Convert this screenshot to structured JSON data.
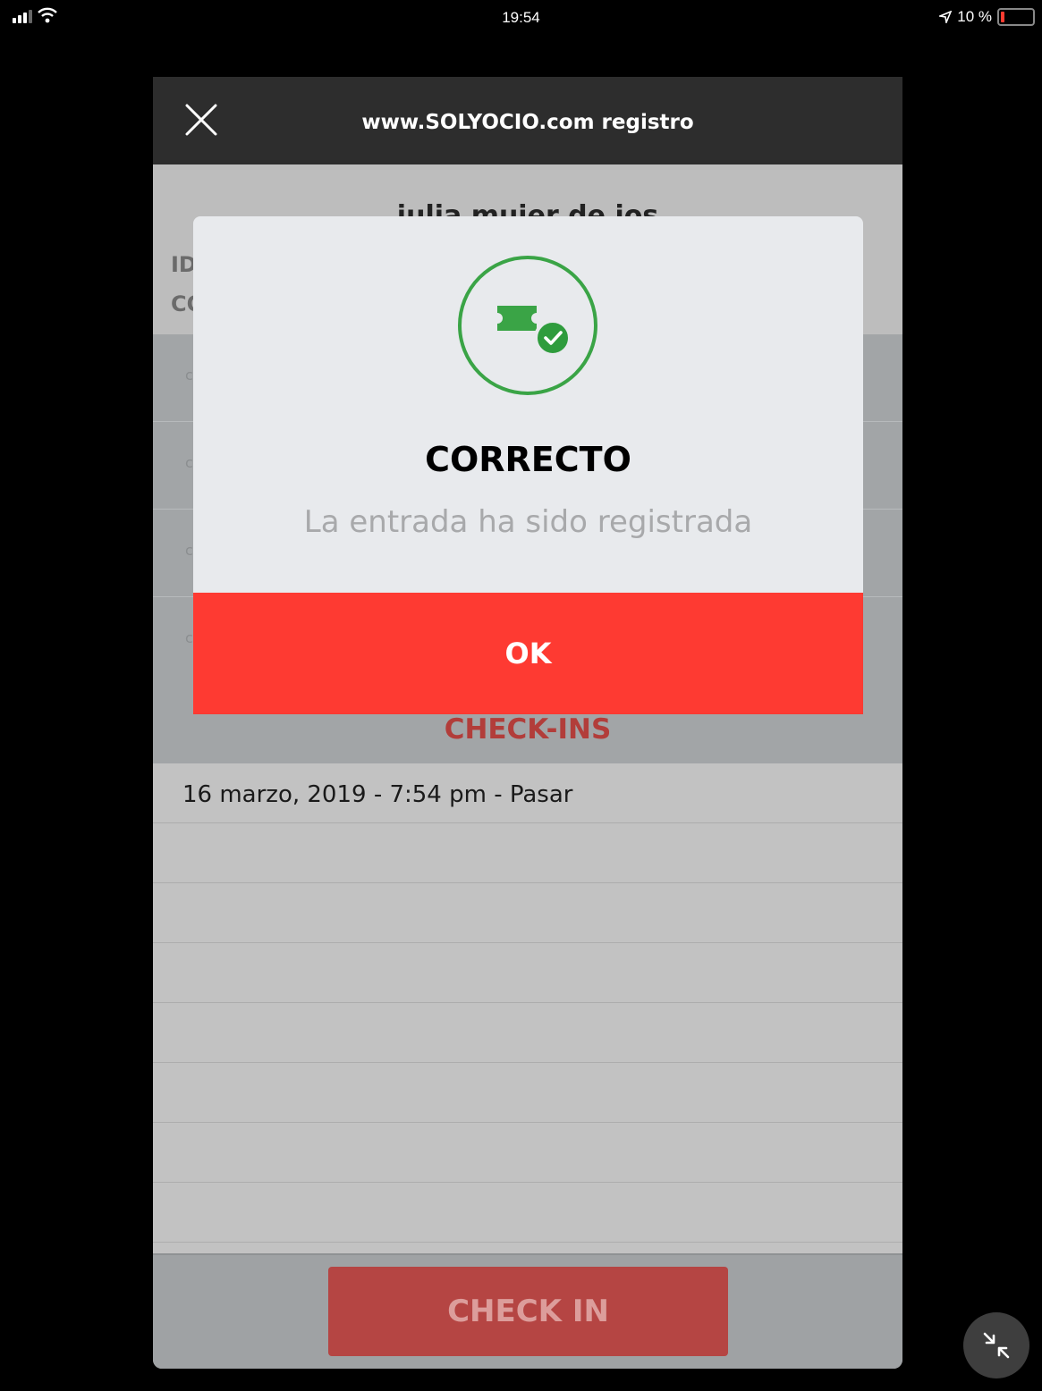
{
  "status_bar": {
    "time": "19:54",
    "battery_text": "10 %",
    "battery_level": 0.1,
    "battery_color": "#ff3b30"
  },
  "navbar": {
    "title": "www.SOLYOCIO.com registro",
    "close_icon": "close-icon"
  },
  "background": {
    "name": "julia mujer de ios",
    "label_1": "ID",
    "label_2": "CO"
  },
  "checkins": {
    "title": "CHECK-INS",
    "title_color": "#b23d3a",
    "items": [
      "16 marzo, 2019 - 7:54 pm - Pasar",
      "",
      "",
      "",
      "",
      "",
      "",
      ""
    ]
  },
  "checkin_button": {
    "label": "CHECK IN",
    "color": "#b54543"
  },
  "modal": {
    "icon": "ticket-check-icon",
    "icon_color": "#3aa446",
    "title": "CORRECTO",
    "message": "La entrada ha sido registrada",
    "ok_label": "OK",
    "ok_color": "#fe3a32"
  },
  "floating_button": {
    "icon": "minimize-arrows-icon"
  }
}
